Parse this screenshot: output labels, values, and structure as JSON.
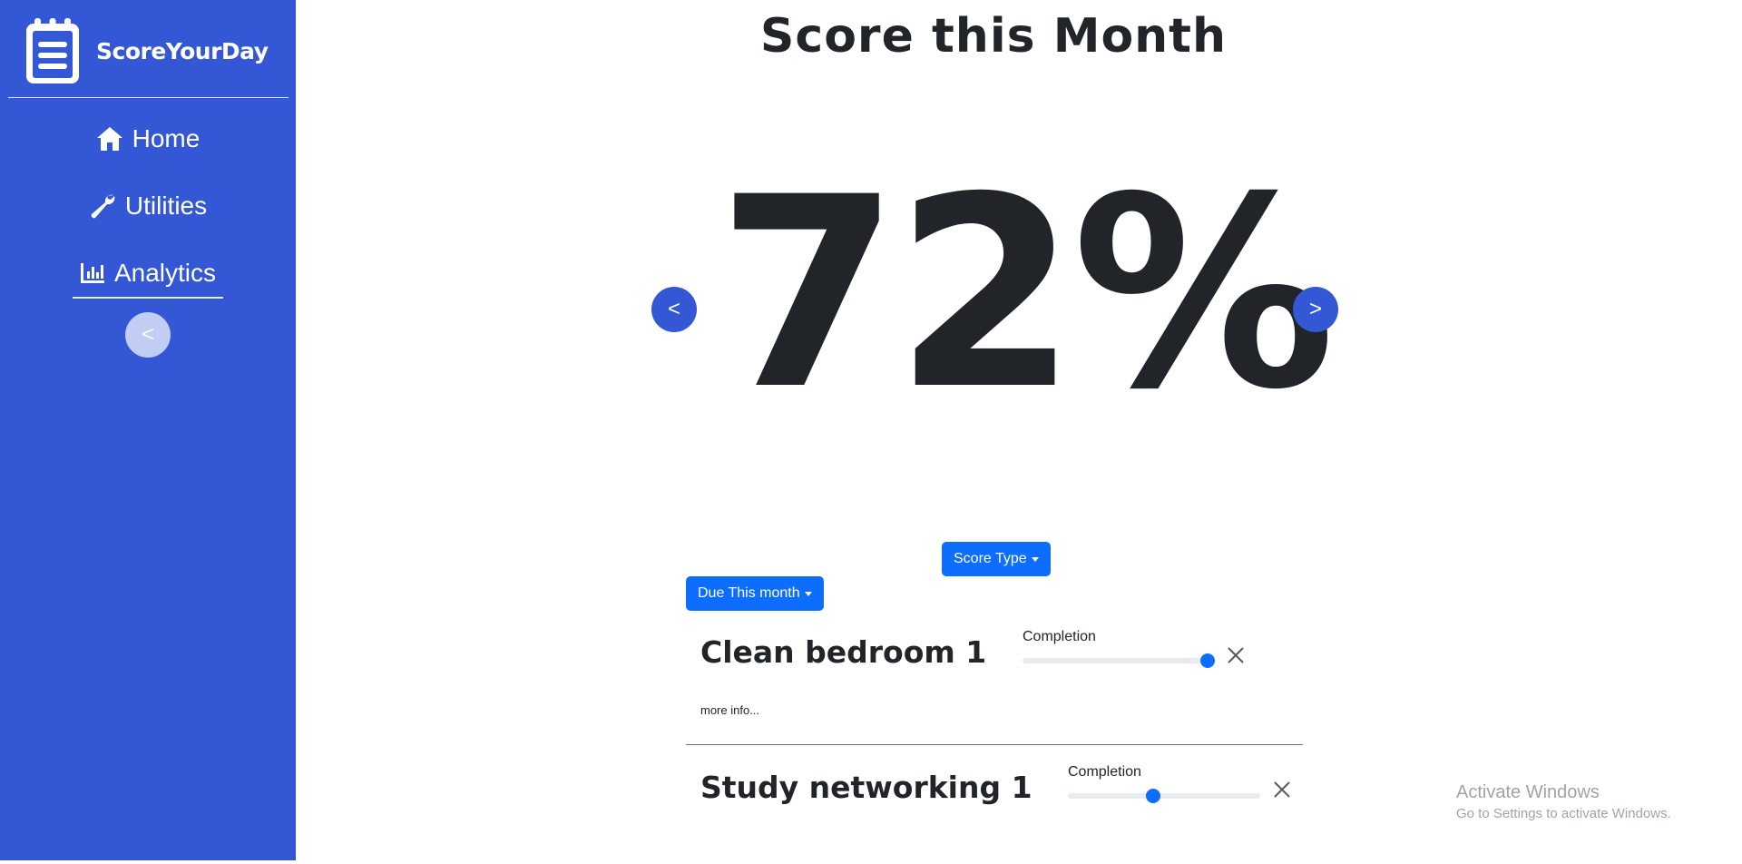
{
  "brand": {
    "name": "ScoreYourDay",
    "icon": "notepad-icon"
  },
  "sidebar": {
    "items": [
      {
        "label": "Home",
        "icon": "home-icon"
      },
      {
        "label": "Utilities",
        "icon": "wrench-icon"
      },
      {
        "label": "Analytics",
        "icon": "bar-chart-icon"
      }
    ],
    "collapse_label": "<"
  },
  "main": {
    "title": "Score this Month",
    "score": "72%",
    "prev_label": "<",
    "next_label": ">",
    "score_type_label": "Score Type",
    "due_filter_label": "Due This month"
  },
  "tasks": [
    {
      "name": "Clean bedroom 1",
      "completion_label": "Completion",
      "completion": 1.0,
      "more_info": "more info..."
    },
    {
      "name": "Study networking 1",
      "completion_label": "Completion",
      "completion": 0.44
    }
  ],
  "watermark": {
    "title": "Activate Windows",
    "subtitle": "Go to Settings to activate Windows."
  },
  "colors": {
    "sidebar": "#3457d5",
    "primary_button": "#0d6efd",
    "text": "#212529"
  }
}
